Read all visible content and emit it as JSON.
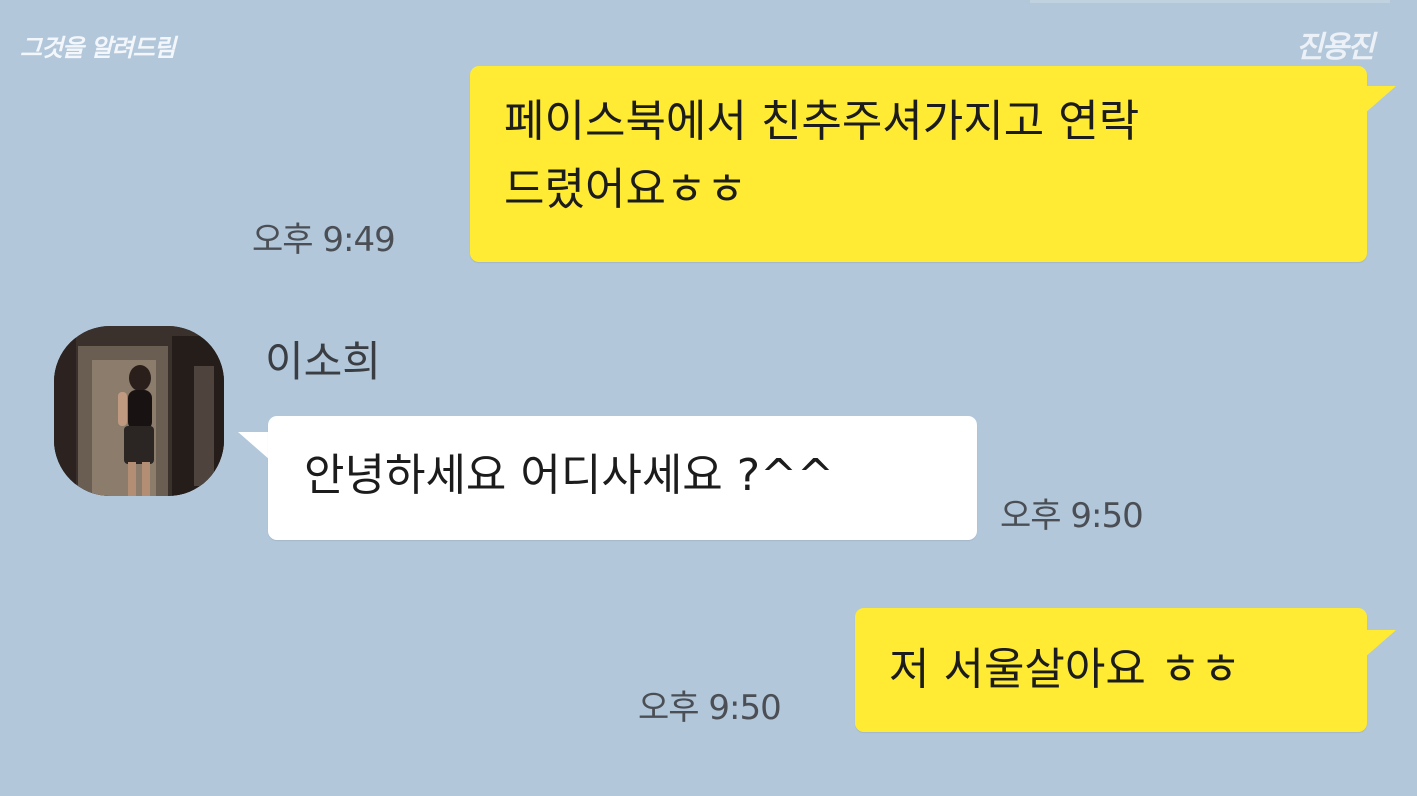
{
  "watermarks": {
    "left": "그것을 알려드림",
    "right": "진용진"
  },
  "messages": [
    {
      "direction": "outgoing",
      "lines": [
        "페이스북에서 친추주셔가지고 연락",
        "드렸어요ㅎㅎ"
      ],
      "time": "오후 9:49"
    },
    {
      "direction": "incoming",
      "sender": "이소희",
      "avatar_icon": "profile-photo-icon",
      "lines": [
        "안녕하세요 어디사세요 ?^^"
      ],
      "time": "오후 9:50"
    },
    {
      "direction": "outgoing",
      "lines": [
        "저 서울살아요 ㅎㅎ"
      ],
      "time": "오후 9:50"
    }
  ],
  "colors": {
    "background": "#b2c7da",
    "outgoing_bubble": "#ffeb33",
    "incoming_bubble": "#ffffff",
    "timestamp_text": "#4b4f55"
  }
}
